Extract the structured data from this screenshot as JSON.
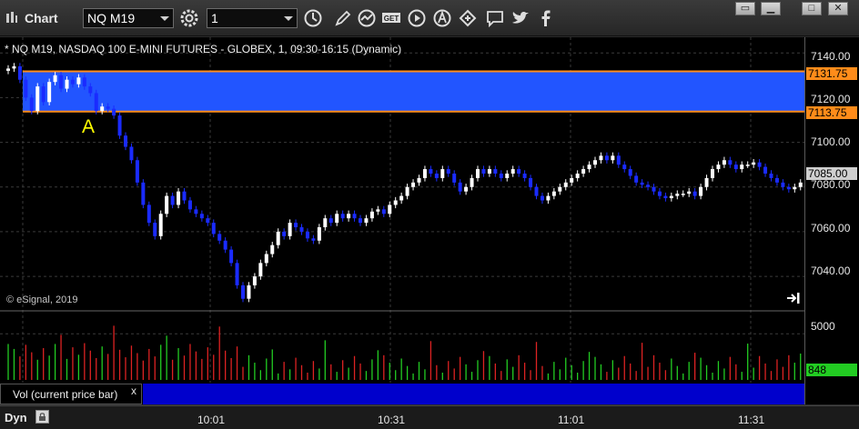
{
  "app": {
    "title": "Chart"
  },
  "toolbar": {
    "symbol": "NQ M19",
    "interval": "1",
    "icons": [
      "settings-gear-icon",
      "clock-icon",
      "draw-pencil-icon",
      "indicator-icon",
      "get-data-icon",
      "play-icon",
      "alert-icon",
      "link-icon",
      "comment-icon",
      "twitter-icon",
      "facebook-icon"
    ],
    "window_buttons": [
      "restore-icon",
      "minimize-icon",
      "maximize-icon",
      "close-icon"
    ]
  },
  "chart": {
    "header": "* NQ M19, NASDAQ 100 E-MINI FUTURES - GLOBEX, 1, 09:30-16:15 (Dynamic)",
    "copyright": "© eSignal, 2019",
    "annotation": "A",
    "price_ticks": [
      "7140.00",
      "7120.00",
      "7100.00",
      "7080.00",
      "7060.00",
      "7040.00"
    ],
    "zone_upper": "7131.75",
    "zone_lower": "7113.75",
    "last_price": "7085.00",
    "zone_color": "#2255ff",
    "zone_line_color": "#ff8c1a",
    "up_color": "#ffffff",
    "down_color": "#1a2bff"
  },
  "volume": {
    "indicator_label": "Vol (current price bar)",
    "close_label": "x",
    "ticks": [
      "5000"
    ],
    "last_volume": "848",
    "up_color": "#22cc22",
    "down_color": "#dd2222"
  },
  "bottom": {
    "mode": "Dyn",
    "time_labels": [
      "10:01",
      "10:31",
      "11:01",
      "11:31"
    ]
  },
  "chart_data": {
    "type": "candlestick",
    "title": "* NQ M19, NASDAQ 100 E-MINI FUTURES - GLOBEX, 1, 09:30-16:15 (Dynamic)",
    "ylim": [
      7025,
      7147
    ],
    "zone": [
      7113.75,
      7131.75
    ],
    "closes": [
      7133,
      7134,
      7128,
      7120,
      7114,
      7125,
      7118,
      7127,
      7130,
      7124,
      7128,
      7126,
      7129,
      7125,
      7122,
      7114,
      7116,
      7115,
      7112,
      7103,
      7098,
      7092,
      7082,
      7072,
      7064,
      7058,
      7068,
      7076,
      7072,
      7078,
      7074,
      7070,
      7068,
      7066,
      7064,
      7059,
      7056,
      7052,
      7046,
      7036,
      7030,
      7036,
      7040,
      7046,
      7050,
      7054,
      7060,
      7058,
      7064,
      7062,
      7060,
      7057,
      7056,
      7062,
      7066,
      7064,
      7068,
      7066,
      7068,
      7066,
      7064,
      7066,
      7069,
      7070,
      7068,
      7072,
      7074,
      7076,
      7080,
      7082,
      7084,
      7088,
      7086,
      7084,
      7088,
      7086,
      7082,
      7078,
      7080,
      7084,
      7088,
      7086,
      7088,
      7086,
      7084,
      7086,
      7088,
      7086,
      7084,
      7080,
      7076,
      7074,
      7076,
      7078,
      7080,
      7082,
      7084,
      7086,
      7088,
      7090,
      7092,
      7094,
      7092,
      7094,
      7090,
      7088,
      7085,
      7082,
      7081,
      7080,
      7078,
      7076,
      7075,
      7076,
      7077,
      7077,
      7078,
      7076,
      7080,
      7084,
      7088,
      7090,
      7092,
      7090,
      7088,
      7090,
      7090,
      7091,
      7089,
      7086,
      7084,
      7082,
      7080,
      7079,
      7080,
      7082,
      7085
    ],
    "volume_ylim": [
      0,
      7000
    ]
  }
}
